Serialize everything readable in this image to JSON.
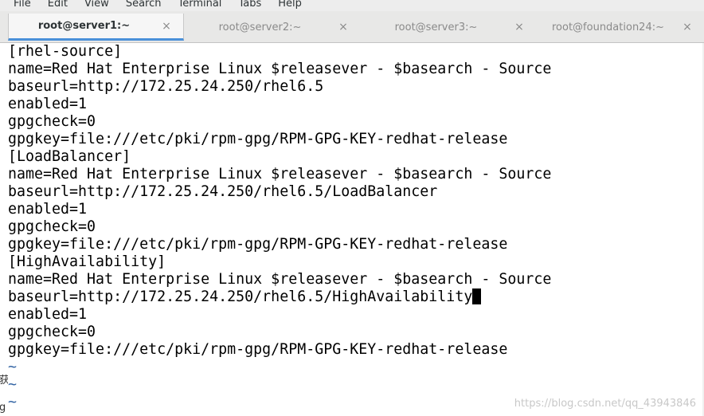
{
  "menubar": {
    "items": [
      "File",
      "Edit",
      "View",
      "Search",
      "Terminal",
      "Tabs",
      "Help"
    ]
  },
  "tabs": [
    {
      "label": "root@server1:~",
      "active": true
    },
    {
      "label": "root@server2:~",
      "active": false
    },
    {
      "label": "root@server3:~",
      "active": false
    },
    {
      "label": "root@foundation24:~",
      "active": false
    }
  ],
  "tab_close_glyph": "×",
  "terminal": {
    "lines": [
      "[rhel-source]",
      "name=Red Hat Enterprise Linux $releasever - $basearch - Source",
      "baseurl=http://172.25.24.250/rhel6.5",
      "enabled=1",
      "gpgcheck=0",
      "gpgkey=file:///etc/pki/rpm-gpg/RPM-GPG-KEY-redhat-release",
      "[LoadBalancer]",
      "name=Red Hat Enterprise Linux $releasever - $basearch - Source",
      "baseurl=http://172.25.24.250/rhel6.5/LoadBalancer",
      "enabled=1",
      "gpgcheck=0",
      "gpgkey=file:///etc/pki/rpm-gpg/RPM-GPG-KEY-redhat-release",
      "[HighAvailability]",
      "name=Red Hat Enterprise Linux $releasever - $basearch - Source",
      "baseurl=http://172.25.24.250/rhel6.5/HighAvailability",
      "enabled=1",
      "gpgcheck=0",
      "gpgkey=file:///etc/pki/rpm-gpg/RPM-GPG-KEY-redhat-release"
    ],
    "cursor_line": 14,
    "tilde_lines": [
      "~",
      "~",
      "~"
    ]
  },
  "left_edge": {
    "glyphs": [
      "获",
      "g"
    ]
  },
  "watermark": "https://blog.csdn.net/qq_43943846",
  "colors": {
    "accent": "#4a90d9",
    "tilde": "#3465a4",
    "text": "#000000"
  }
}
